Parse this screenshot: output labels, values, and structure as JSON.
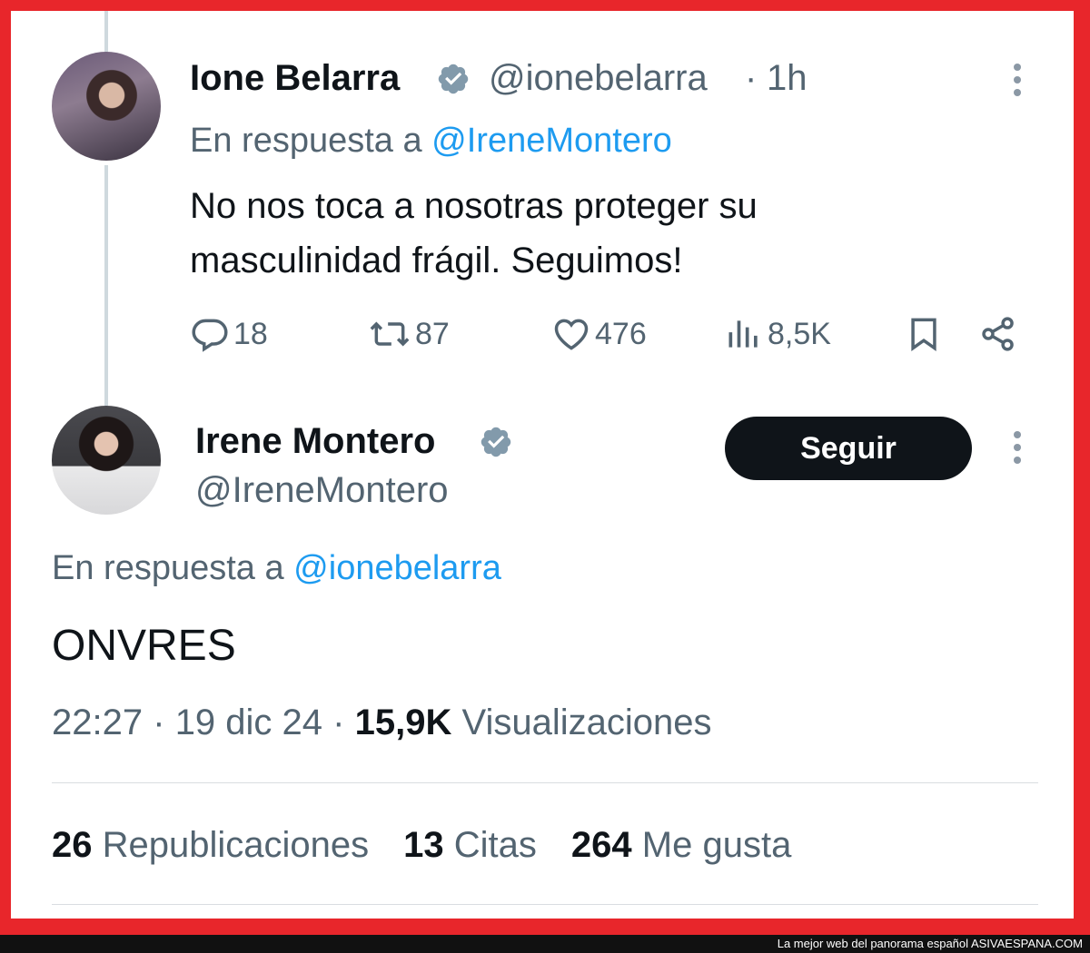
{
  "tweet1": {
    "author_name": "Ione Belarra",
    "handle": "@ionebelarra",
    "separator": "·",
    "time": "1h",
    "reply_prefix": "En respuesta a",
    "reply_mention": "@IreneMontero",
    "text_line1": "No nos toca a nosotras proteger su",
    "text_line2": "masculinidad frágil. Seguimos!",
    "replies": "18",
    "reposts": "87",
    "likes": "476",
    "views": "8,5K"
  },
  "tweet2": {
    "author_name": "Irene Montero",
    "handle": "@IreneMontero",
    "follow_label": "Seguir",
    "reply_prefix": "En respuesta a",
    "reply_mention": "@ionebelarra",
    "text": "ONVRES",
    "time": "22:27",
    "date": "19 dic 24",
    "separator": "·",
    "views_count": "15,9K",
    "views_label": "Visualizaciones",
    "reposts_count": "26",
    "reposts_label": "Republicaciones",
    "quotes_count": "13",
    "quotes_label": "Citas",
    "likes_count": "264",
    "likes_label": "Me gusta"
  },
  "footer": {
    "text": "La mejor web del panorama español",
    "brand": "ASIVAESPANA.COM"
  },
  "colors": {
    "frame_border": "#e8262b",
    "link": "#1d9bf0",
    "muted": "#536471",
    "text": "#0f1419",
    "verified_badge": "#829aab"
  },
  "icons": [
    "verified-badge-icon",
    "more-dots-icon",
    "reply-icon",
    "repost-icon",
    "like-icon",
    "views-icon",
    "bookmark-icon",
    "share-icon"
  ]
}
